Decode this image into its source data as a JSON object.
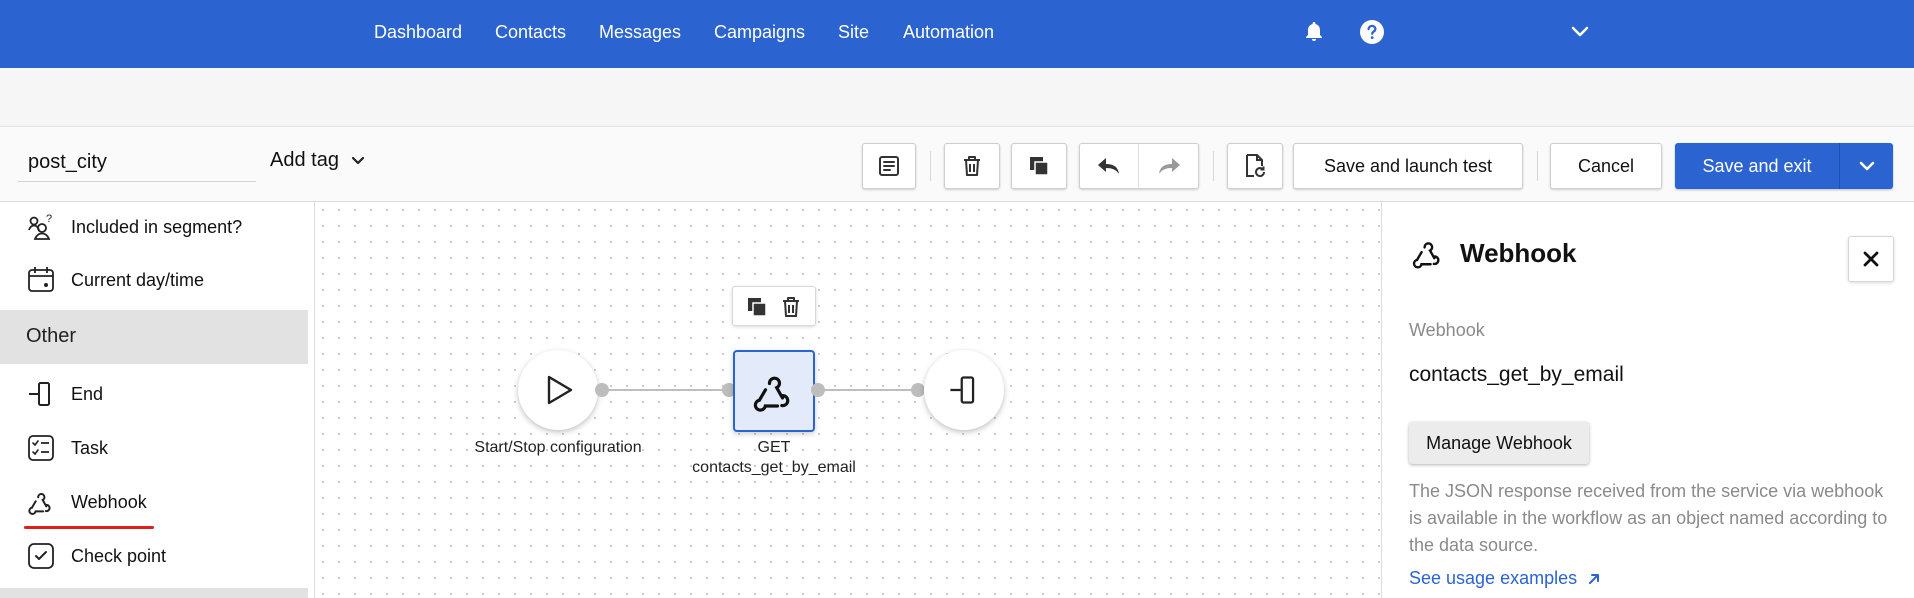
{
  "nav": {
    "links": [
      "Dashboard",
      "Contacts",
      "Messages",
      "Campaigns",
      "Site",
      "Automation"
    ],
    "icons": [
      "bell-icon",
      "help-icon",
      "chevron-down-icon"
    ]
  },
  "toolbar": {
    "workflow_name": "post_city",
    "add_tag_label": "Add tag",
    "save_launch_label": "Save and launch test",
    "cancel_label": "Cancel",
    "save_exit_label": "Save and exit"
  },
  "palette": {
    "items": [
      {
        "label": "Included in segment?",
        "icon": "segment-question-icon"
      },
      {
        "label": "Current day/time",
        "icon": "calendar-clock-icon"
      }
    ],
    "section_title": "Other",
    "other_items": [
      {
        "label": "End",
        "icon": "end-icon"
      },
      {
        "label": "Task",
        "icon": "task-list-icon"
      },
      {
        "label": "Webhook",
        "icon": "webhook-icon"
      },
      {
        "label": "Check point",
        "icon": "checkpoint-icon"
      }
    ]
  },
  "canvas": {
    "nodes": [
      {
        "label": "Start/Stop configuration",
        "icon": "play-icon"
      },
      {
        "label_line1": "GET",
        "label_line2": "contacts_get_by_email",
        "icon": "webhook-icon",
        "selected": true
      },
      {
        "label": "",
        "icon": "end-icon"
      }
    ]
  },
  "panel": {
    "title": "Webhook",
    "field_label": "Webhook",
    "field_value": "contacts_get_by_email",
    "manage_label": "Manage Webhook",
    "description": "The JSON response received from the service via webhook is available in the workflow as an object named according to the data source.",
    "link_label": "See usage examples"
  },
  "colors": {
    "brand": "#2b63d1",
    "highlight_underline": "#e11d1d",
    "selected_node_fill": "#e3ebfb"
  }
}
